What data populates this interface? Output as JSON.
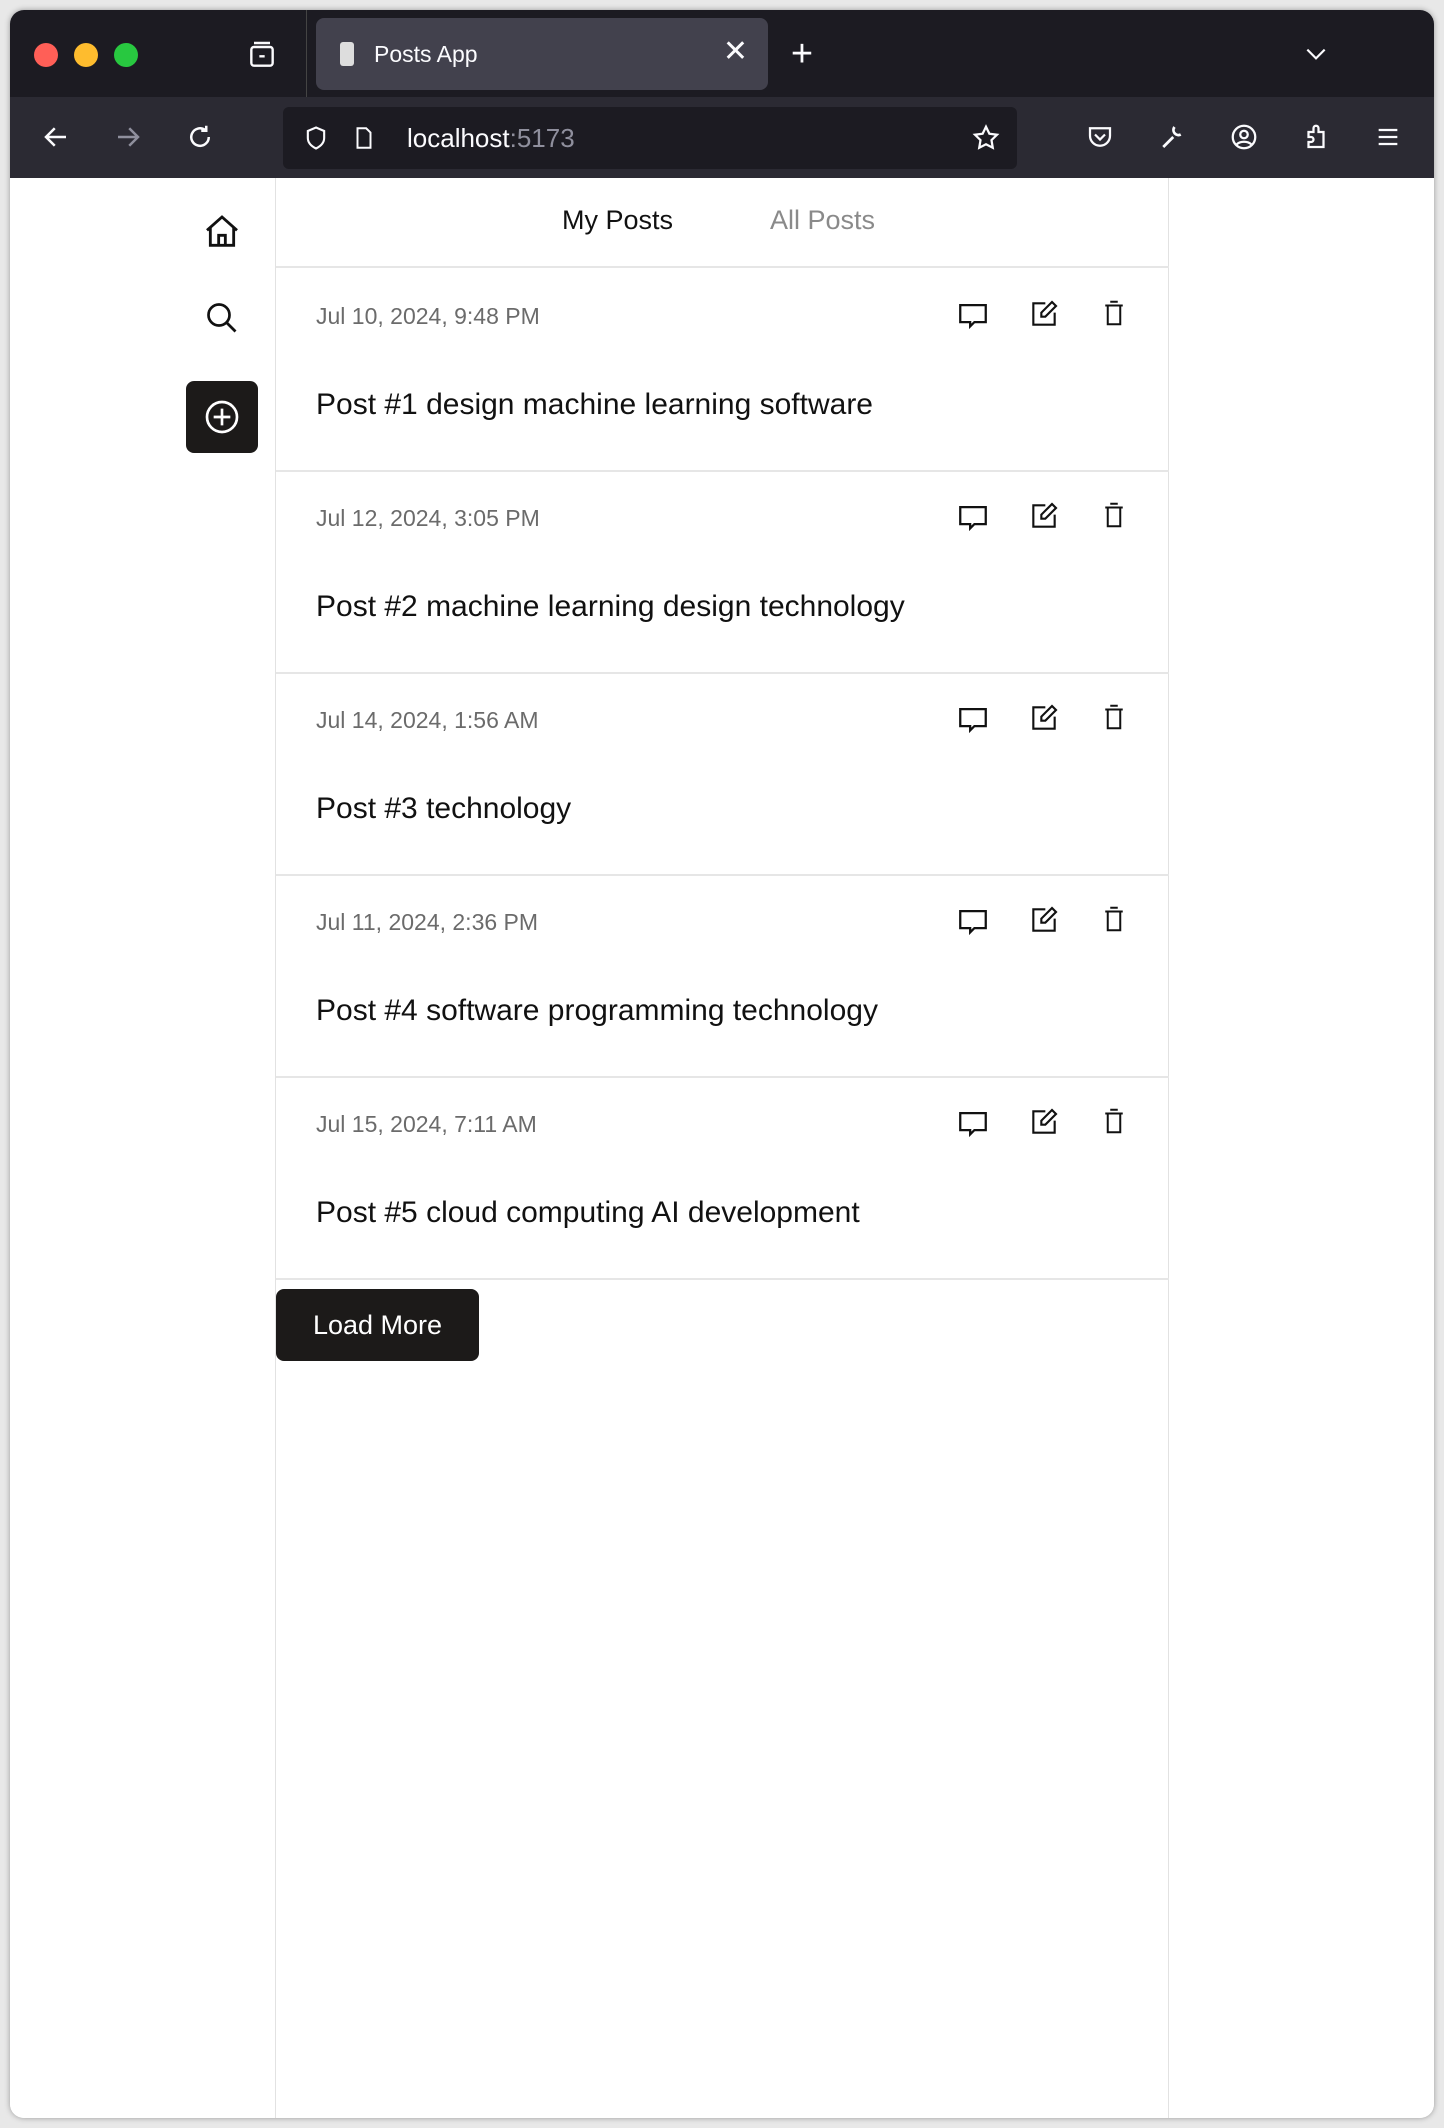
{
  "browser": {
    "tab_title": "Posts App",
    "url_host": "localhost",
    "url_port": ":5173",
    "traffic_lights": [
      "#ff5f57",
      "#febc2e",
      "#28c840"
    ]
  },
  "tabs": {
    "my_posts": "My Posts",
    "all_posts": "All Posts",
    "active": "My Posts"
  },
  "posts": [
    {
      "date": "Jul 10, 2024, 9:48 PM",
      "title": "Post #1 design machine learning software"
    },
    {
      "date": "Jul 12, 2024, 3:05 PM",
      "title": "Post #2 machine learning design technology"
    },
    {
      "date": "Jul 14, 2024, 1:56 AM",
      "title": "Post #3 technology"
    },
    {
      "date": "Jul 11, 2024, 2:36 PM",
      "title": "Post #4 software programming technology"
    },
    {
      "date": "Jul 15, 2024, 7:11 AM",
      "title": "Post #5 cloud computing AI development"
    }
  ],
  "load_more": "Load More",
  "icons": {
    "sidebar": [
      "home-icon",
      "search-icon",
      "plus-circle-icon"
    ],
    "post_actions": [
      "comment-icon",
      "edit-icon",
      "trash-icon"
    ]
  }
}
